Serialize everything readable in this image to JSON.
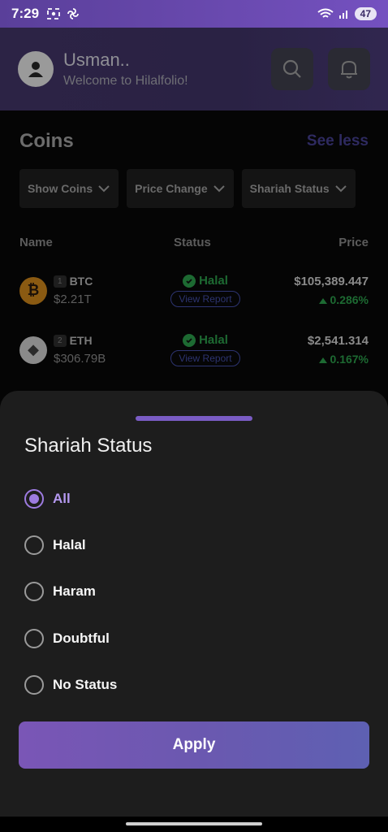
{
  "status_bar": {
    "time": "7:29",
    "battery": "47"
  },
  "header": {
    "user_name": "Usman..",
    "welcome": "Welcome to Hilalfolio!"
  },
  "coins": {
    "title": "Coins",
    "see_less": "See less",
    "filters": [
      "Show Coins",
      "Price Change",
      "Shariah Status"
    ],
    "columns": {
      "name": "Name",
      "status": "Status",
      "price": "Price"
    },
    "rows": [
      {
        "rank": "1",
        "symbol": "BTC",
        "market_cap": "$2.21T",
        "status": "Halal",
        "report": "View Report",
        "price": "$105,389.447",
        "change": "0.286%",
        "icon_color": "#8a5a12",
        "icon_glyph": "₿"
      },
      {
        "rank": "2",
        "symbol": "ETH",
        "market_cap": "$306.79B",
        "status": "Halal",
        "report": "View Report",
        "price": "$2,541.314",
        "change": "0.167%",
        "icon_color": "#8a8a8a",
        "icon_glyph": "◆"
      }
    ]
  },
  "sheet": {
    "title": "Shariah Status",
    "options": [
      "All",
      "Halal",
      "Haram",
      "Doubtful",
      "No Status"
    ],
    "selected": "All",
    "apply_label": "Apply"
  },
  "colors": {
    "accent": "#9d7be0",
    "halal": "#1d6a32"
  }
}
